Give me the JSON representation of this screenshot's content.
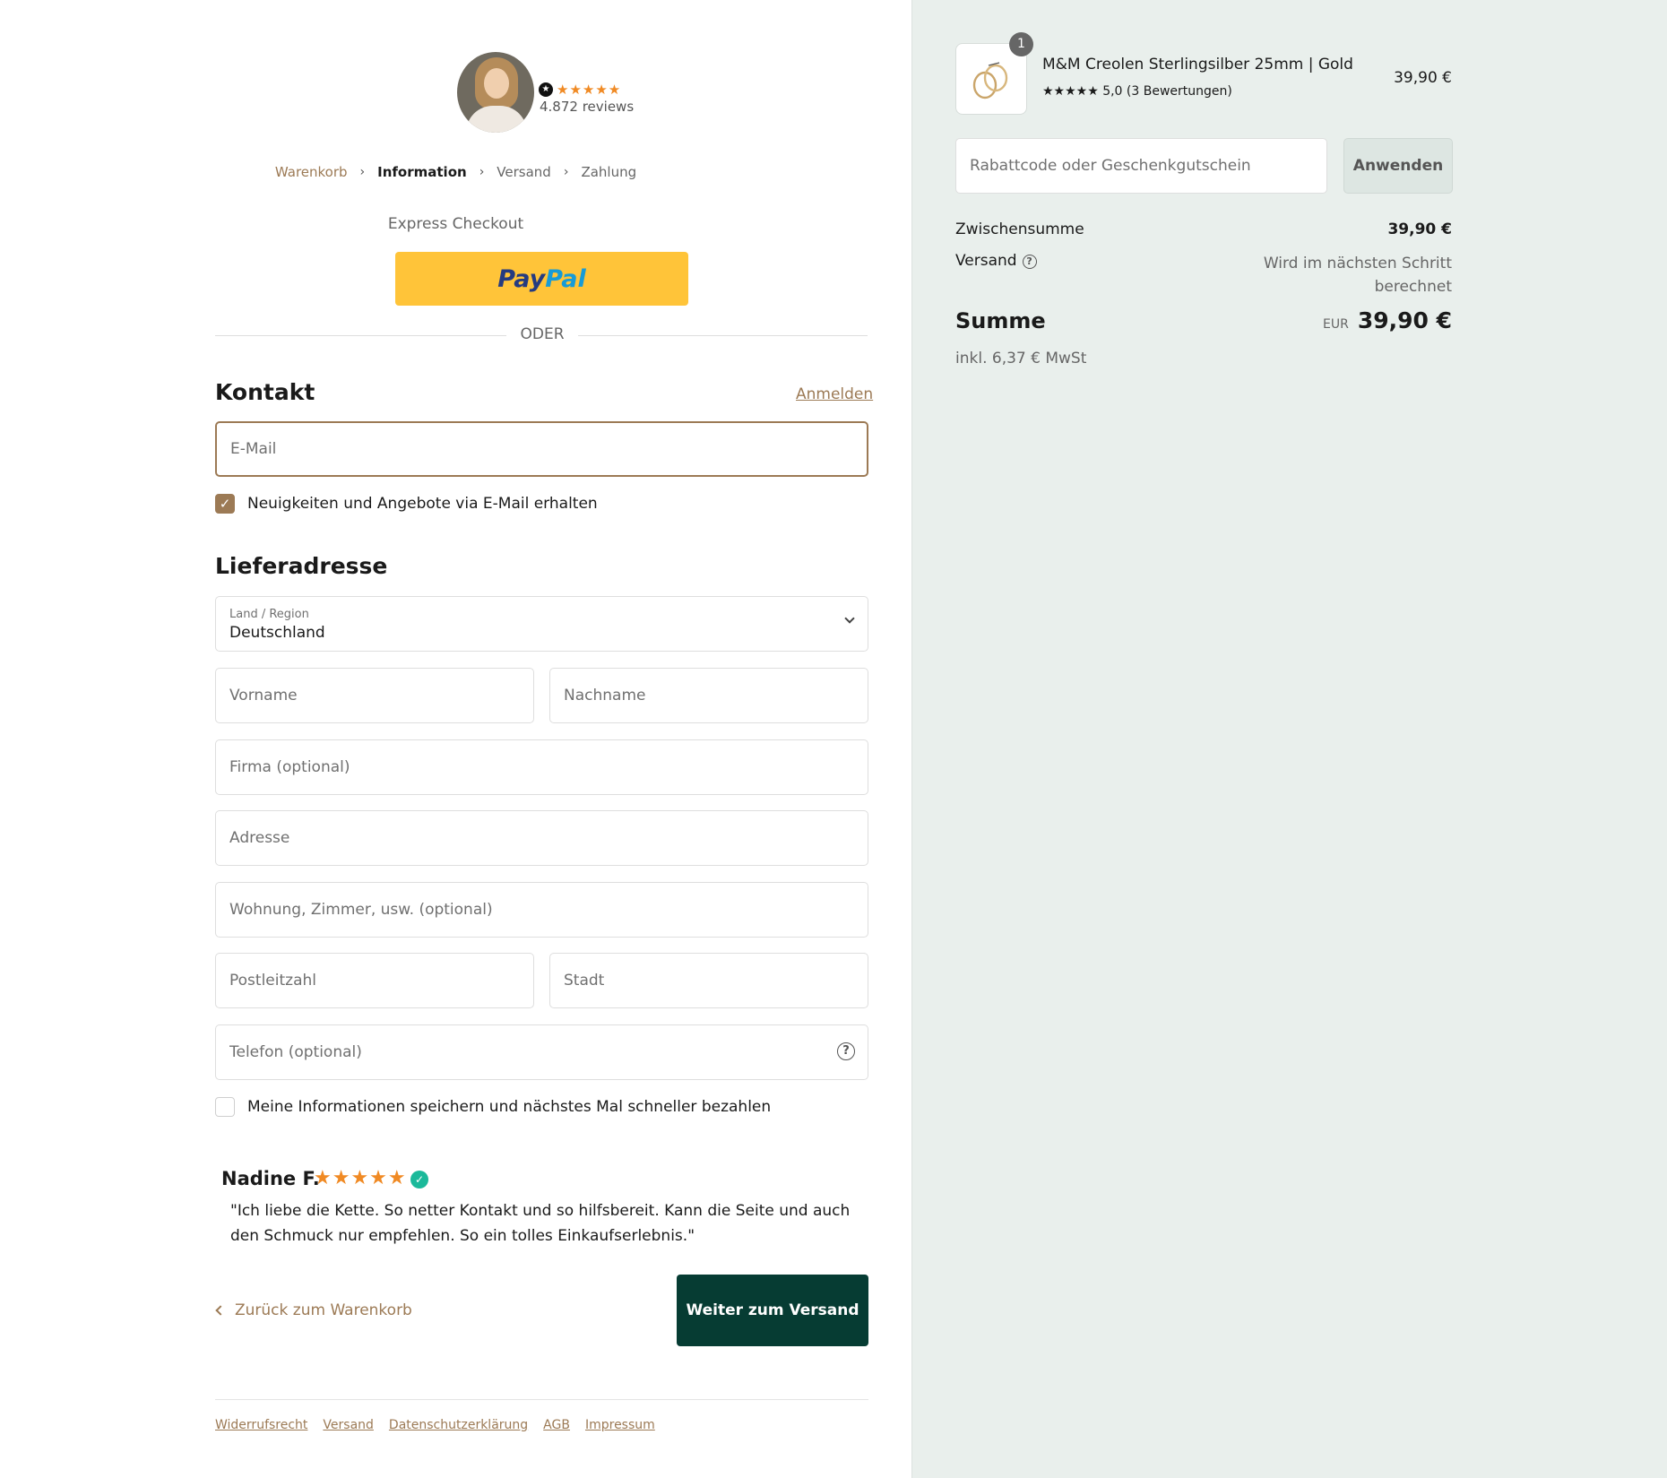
{
  "header": {
    "rating_stars": "★★★★★",
    "reviews_count": "4.872 reviews"
  },
  "breadcrumb": {
    "items": [
      {
        "label": "Warenkorb",
        "state": "link"
      },
      {
        "label": "Information",
        "state": "active"
      },
      {
        "label": "Versand",
        "state": "muted"
      },
      {
        "label": "Zahlung",
        "state": "muted"
      }
    ],
    "separator": "›"
  },
  "express": {
    "title": "Express Checkout",
    "paypal_part1": "Pay",
    "paypal_part2": "Pal",
    "divider": "ODER"
  },
  "contact": {
    "title": "Kontakt",
    "login_link": "Anmelden",
    "email_placeholder": "E-Mail",
    "newsletter_label": "Neuigkeiten und Angebote via E-Mail erhalten",
    "newsletter_checked": true
  },
  "shipping": {
    "title": "Lieferadresse",
    "country_label": "Land / Region",
    "country_value": "Deutschland",
    "first_name_placeholder": "Vorname",
    "last_name_placeholder": "Nachname",
    "company_placeholder": "Firma (optional)",
    "address_placeholder": "Adresse",
    "apartment_placeholder": "Wohnung, Zimmer, usw. (optional)",
    "zip_placeholder": "Postleitzahl",
    "city_placeholder": "Stadt",
    "phone_placeholder": "Telefon (optional)",
    "save_info_label": "Meine Informationen speichern und nächstes Mal schneller bezahlen",
    "save_info_checked": false
  },
  "review": {
    "name": "Nadine F.",
    "stars": "★★★★★",
    "text": "\"Ich liebe die Kette. So netter Kontakt und so hilfsbereit. Kann die Seite und auch den Schmuck nur empfehlen. So ein tolles Einkaufserlebnis.\""
  },
  "actions": {
    "back_label": "Zurück zum Warenkorb",
    "continue_label": "Weiter zum Versand"
  },
  "footer": {
    "links": [
      "Widerrufsrecht",
      "Versand",
      "Datenschutzerklärung",
      "AGB",
      "Impressum"
    ]
  },
  "summary": {
    "item": {
      "quantity": "1",
      "name": "M&M Creolen Sterlingsilber 25mm | Gold",
      "rating": "★★★★★ 5,0 (3 Bewertungen)",
      "price": "39,90 €"
    },
    "discount_placeholder": "Rabattcode oder Geschenkgutschein",
    "apply_label": "Anwenden",
    "subtotal_label": "Zwischensumme",
    "subtotal_value": "39,90 €",
    "shipping_label": "Versand",
    "shipping_value_line1": "Wird im nächsten Schritt",
    "shipping_value_line2": "berechnet",
    "total_label": "Summe",
    "total_currency": "EUR",
    "total_value": "39,90 €",
    "tax_note": "inkl. 6,37 € MwSt"
  },
  "colors": {
    "accent": "#9c7a55",
    "primary_button": "#063c33",
    "paypal_yellow": "#ffc439",
    "summary_bg": "#e9efec",
    "star_orange": "#f08a24"
  }
}
